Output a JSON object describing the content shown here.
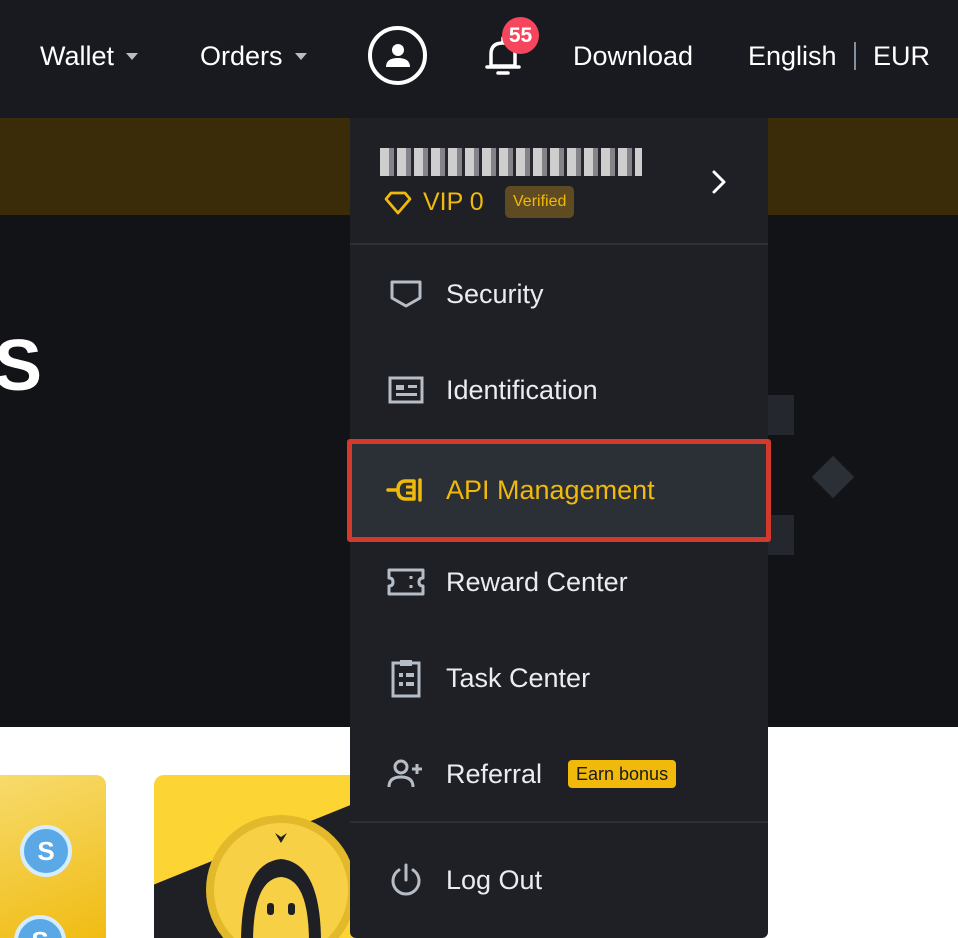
{
  "nav": {
    "wallet_label": "Wallet",
    "orders_label": "Orders",
    "notification_count": "55",
    "download_label": "Download",
    "language_label": "English",
    "currency_label": "EUR"
  },
  "hero": {
    "partial_heading": "S"
  },
  "profile": {
    "vip_level": "VIP 0",
    "verified_label": "Verified"
  },
  "menu": {
    "items": [
      {
        "label": "Security",
        "icon": "shield-icon"
      },
      {
        "label": "Identification",
        "icon": "id-card-icon"
      },
      {
        "label": "API Management",
        "icon": "api-plug-icon",
        "active": true
      },
      {
        "label": "Reward Center",
        "icon": "ticket-icon"
      },
      {
        "label": "Task Center",
        "icon": "clipboard-icon"
      },
      {
        "label": "Referral",
        "icon": "add-user-icon",
        "badge": "Earn bonus"
      },
      {
        "label": "Log Out",
        "icon": "power-icon"
      }
    ]
  },
  "colors": {
    "nav_bg": "#181a20",
    "menu_bg": "#1e2026",
    "accent": "#f0b90b",
    "notification": "#f6465d",
    "highlight_border": "#d33a2c"
  }
}
